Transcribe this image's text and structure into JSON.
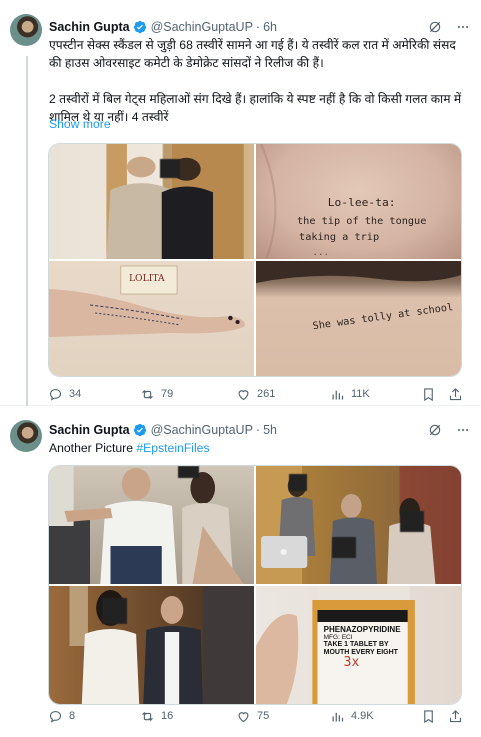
{
  "tweets": [
    {
      "author": {
        "name": "Sachin Gupta",
        "handle": "@SachinGuptaUP",
        "time": "6h"
      },
      "text": [
        "एपस्टीन सेक्स स्कैंडल से जुड़ी 68 तस्वीरें सामने आ गई हैं। ये तस्वीरें कल रात में अमेरिकी संसद की हाउस ओवरसाइट कमेटी के डेमोक्रेट सांसदों ने रिलीज की हैं।",
        "2 तस्वीरों में बिल गेट्स महिलाओं संग दिखे हैं। हालांकि ये स्पष्ट नहीं है कि वो किसी गलत काम में शामिल थे या नहीं। 4 तस्वीरें"
      ],
      "show_more": "Show more",
      "images": [
        {
          "icon": "photo-man-and-woman"
        },
        {
          "icon": "photo-handwriting-on-back",
          "caption": "Lo-lee-ta: the tip of the tongue taking a trip"
        },
        {
          "icon": "photo-handwriting-on-foot",
          "caption": ""
        },
        {
          "icon": "photo-handwriting-on-shoulder",
          "caption": "She was tolly at school"
        }
      ],
      "stats": {
        "replies": "34",
        "reposts": "79",
        "likes": "261",
        "views": "11K"
      }
    },
    {
      "author": {
        "name": "Sachin Gupta",
        "handle": "@SachinGuptaUP",
        "time": "5h"
      },
      "text_plain": "Another Picture ",
      "hashtag": "#EpsteinFiles",
      "images": [
        {
          "icon": "photo-man-on-plane"
        },
        {
          "icon": "photo-group-with-laptop"
        },
        {
          "icon": "photo-man-and-woman-hallway"
        },
        {
          "icon": "photo-pill-bottle",
          "label_lines": [
            "PHENAZOPYRIDINE",
            "MFG: ECI",
            "TAKE 1 TABLET BY",
            "MOUTH EVERY EIGHT",
            "3x"
          ]
        }
      ],
      "stats": {
        "replies": "8",
        "reposts": "16",
        "likes": "75",
        "views": "4.9K"
      }
    }
  ],
  "colors": {
    "accent": "#1d9bf0",
    "text": "#0f1419",
    "muted": "#536471",
    "border": "#cfd9de"
  }
}
